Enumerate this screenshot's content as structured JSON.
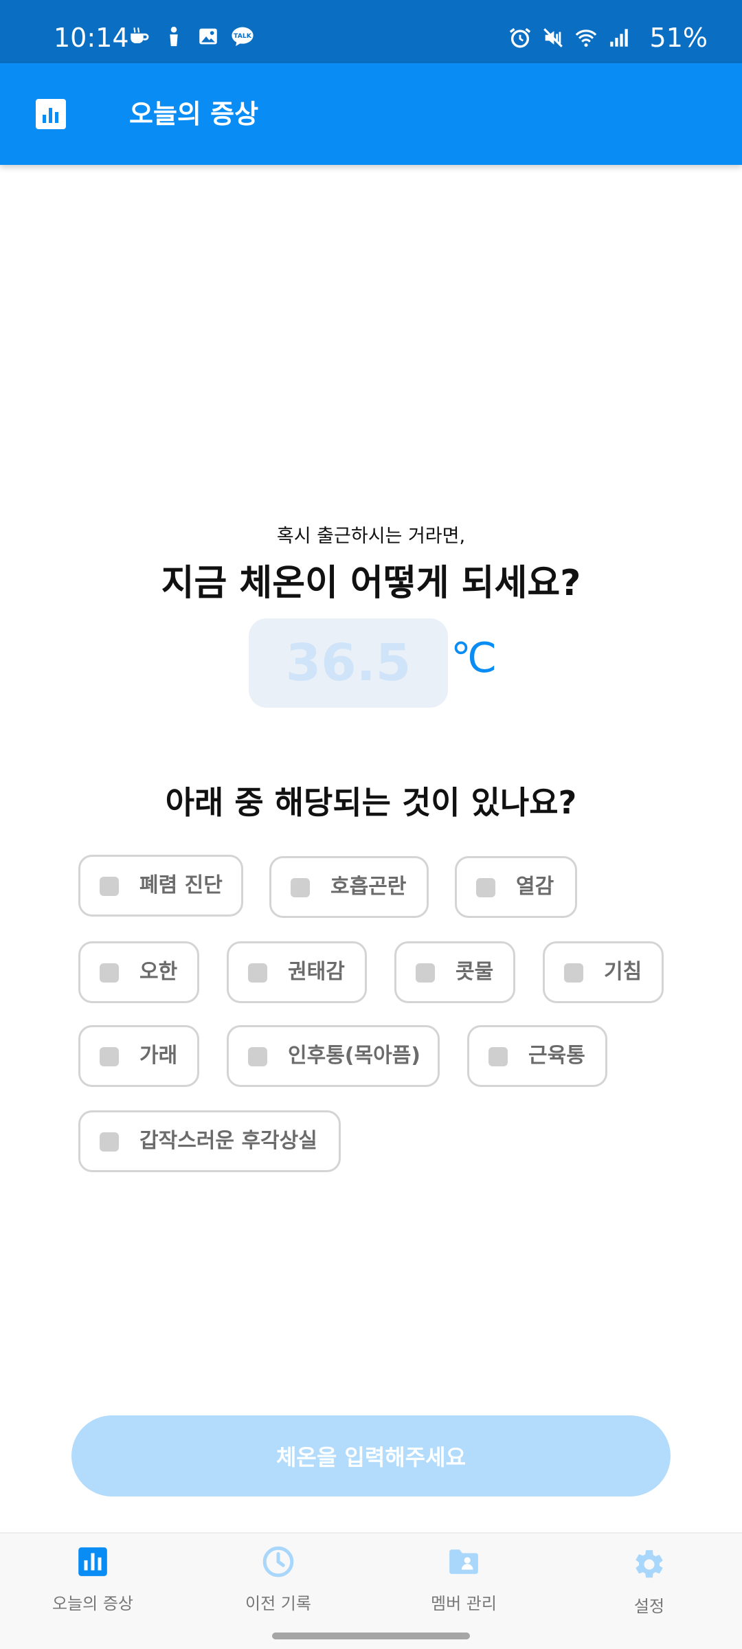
{
  "status_bar": {
    "time": "10:14",
    "battery": "51%",
    "left_icons": [
      "coffee-icon",
      "figure-icon",
      "image-icon",
      "talk-icon"
    ],
    "right_icons": [
      "alarm-icon",
      "mute-icon",
      "wifi-icon",
      "signal-icon"
    ],
    "talk_badge": "TALK"
  },
  "app_bar": {
    "title": "오늘의 증상",
    "icon": "bar-chart-icon",
    "background": "#0a8cf5"
  },
  "main": {
    "subtitle": "혹시 출근하시는 거라면,",
    "headline": "지금 체온이 어떻게 되세요?",
    "temperature": {
      "value": "",
      "placeholder": "36.5",
      "unit": "℃"
    },
    "question": "아래 중 해당되는 것이 있나요?",
    "symptoms": [
      {
        "label": "폐렴 진단",
        "checked": false
      },
      {
        "label": "호흡곤란",
        "checked": false
      },
      {
        "label": "열감",
        "checked": false
      },
      {
        "label": "오한",
        "checked": false
      },
      {
        "label": "권태감",
        "checked": false
      },
      {
        "label": "콧물",
        "checked": false
      },
      {
        "label": "기침",
        "checked": false
      },
      {
        "label": "가래",
        "checked": false
      },
      {
        "label": "인후통(목아픔)",
        "checked": false
      },
      {
        "label": "근육통",
        "checked": false
      },
      {
        "label": "갑작스러운 후각상실",
        "checked": false
      }
    ],
    "submit_label": "체온을 입력해주세요"
  },
  "bottom_nav": {
    "items": [
      {
        "label": "오늘의 증상",
        "icon": "bar-chart-icon",
        "active": true
      },
      {
        "label": "이전 기록",
        "icon": "clock-icon",
        "active": false
      },
      {
        "label": "멤버 관리",
        "icon": "member-folder-icon",
        "active": false
      },
      {
        "label": "설정",
        "icon": "gear-icon",
        "active": false
      }
    ]
  },
  "colors": {
    "primary": "#0a8cf5",
    "status_bar": "#0a6fc2",
    "primary_light": "#b3dcfc",
    "inactive_icon": "#a9d7fb"
  }
}
